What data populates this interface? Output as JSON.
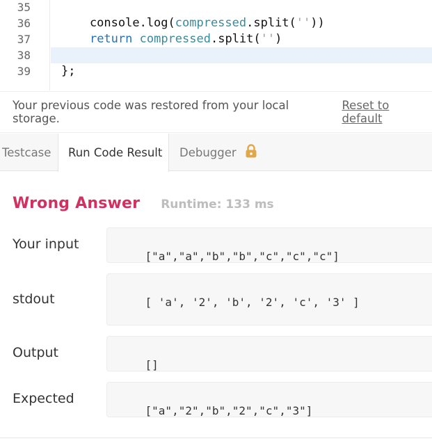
{
  "editor": {
    "lines": [
      {
        "num": "35",
        "tokens": []
      },
      {
        "num": "36",
        "tokens": [
          {
            "t": "    console.log(",
            "c": ""
          },
          {
            "t": "compressed",
            "c": "var"
          },
          {
            "t": ".split(",
            "c": ""
          },
          {
            "t": "''",
            "c": "str"
          },
          {
            "t": "))",
            "c": ""
          }
        ]
      },
      {
        "num": "37",
        "tokens": [
          {
            "t": "    ",
            "c": ""
          },
          {
            "t": "return",
            "c": "kw"
          },
          {
            "t": " ",
            "c": ""
          },
          {
            "t": "compressed",
            "c": "var"
          },
          {
            "t": ".split(",
            "c": ""
          },
          {
            "t": "''",
            "c": "str"
          },
          {
            "t": ")",
            "c": ""
          }
        ]
      },
      {
        "num": "38",
        "tokens": []
      },
      {
        "num": "39",
        "tokens": [
          {
            "t": "};",
            "c": ""
          }
        ]
      }
    ]
  },
  "notice": {
    "message": "Your previous code was restored from your local storage.",
    "reset_label": "Reset to default"
  },
  "tabs": {
    "testcase": "Testcase",
    "run_result": "Run Code Result",
    "debugger": "Debugger"
  },
  "result": {
    "verdict": "Wrong Answer",
    "runtime": "Runtime: 133 ms",
    "input_label": "Your input",
    "input_value": "[\"a\",\"a\",\"b\",\"b\",\"c\",\"c\",\"c\"]",
    "stdout_label": "stdout",
    "stdout_value": "[ 'a', '2', 'b', '2', 'c', '3' ]",
    "output_label": "Output",
    "output_value": "[]",
    "expected_label": "Expected",
    "expected_value": "[\"a\",\"2\",\"b\",\"2\",\"c\",\"3\"]"
  },
  "colors": {
    "verdict": "#d23060",
    "keyword": "#2672b8",
    "variable": "#3a8a9a",
    "lock": "#e0a84a"
  }
}
